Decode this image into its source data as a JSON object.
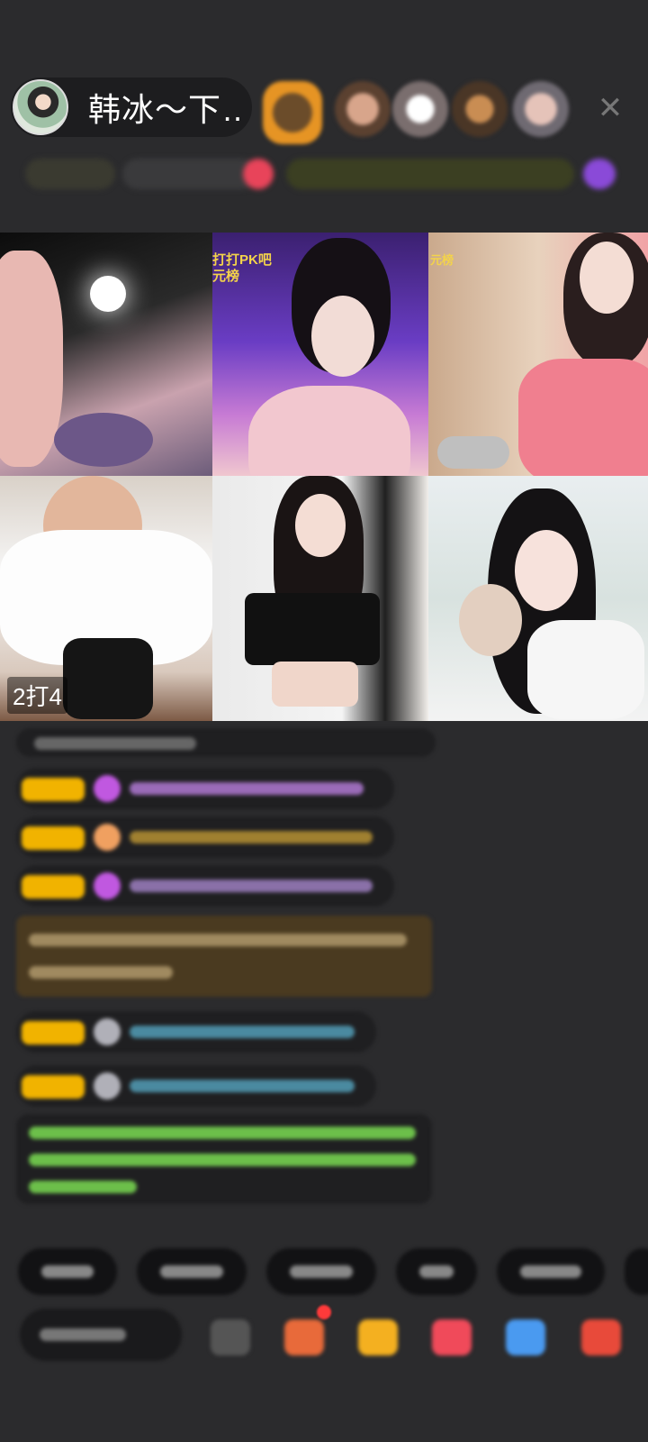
{
  "host": {
    "name": "韩冰～下…"
  },
  "header": {
    "close_icon": "close-icon",
    "viewer_count_visible": 5
  },
  "pk": {
    "badge": "2打4",
    "overlay_line1": "打打PK吧",
    "overlay_line2": "元榜",
    "rank_overlay": "元榜"
  },
  "colors": {
    "background": "#2b2b2d",
    "level_badge": "#f1b300",
    "highlight_message": "#4a3a20",
    "system_text": "#6cbf4a",
    "notification_dot": "#ff3a3a"
  },
  "toolbar": {
    "icons": [
      "more-icon",
      "gift-box-icon",
      "gift-icon",
      "red-envelope-icon",
      "game-icon",
      "shop-icon"
    ]
  }
}
